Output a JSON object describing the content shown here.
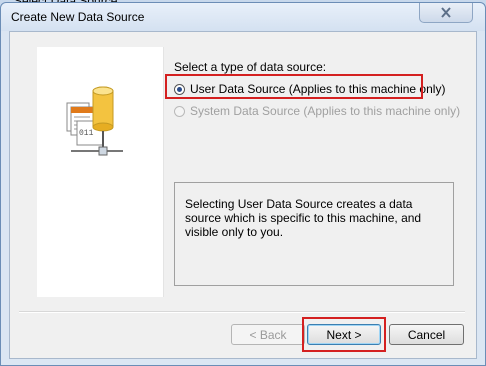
{
  "background_window": {
    "title": "Select Data Source"
  },
  "dialog": {
    "title": "Create New Data Source",
    "close_icon": "close-icon",
    "prompt": "Select a type of data source:",
    "options": [
      {
        "label": "User Data Source (Applies to this machine only)",
        "selected": true,
        "enabled": true
      },
      {
        "label": "System Data Source (Applies to this machine only)",
        "selected": false,
        "enabled": false
      }
    ],
    "description": "Selecting User Data Source creates a data source which is specific to this machine, and visible only to you.",
    "illustration": {
      "icon": "data-source-icon",
      "digits": "011"
    },
    "buttons": {
      "back": "< Back",
      "next": "Next >",
      "cancel": "Cancel"
    }
  },
  "colors": {
    "highlight": "#d42020",
    "dialog_frame": "#dbe6f3",
    "client_bg": "#f0f0f0"
  }
}
